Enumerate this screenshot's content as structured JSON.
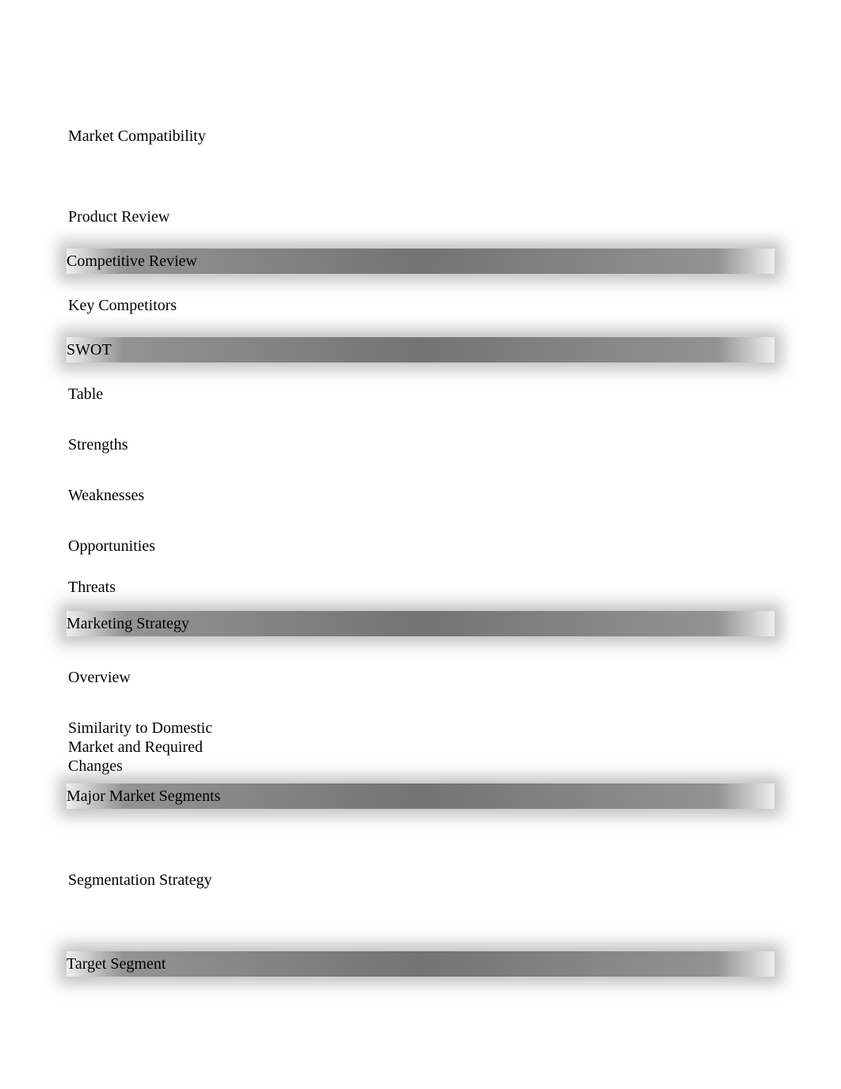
{
  "items": [
    {
      "type": "text",
      "text": "Market Compatibility",
      "spacer_after": "large"
    },
    {
      "type": "text",
      "text": "Product Review",
      "spacer_after": "small"
    },
    {
      "type": "heading",
      "text": "Competitive Review",
      "spacer_after": "small"
    },
    {
      "type": "text",
      "text": "Key Competitors",
      "spacer_after": "small"
    },
    {
      "type": "heading",
      "text": "SWOT",
      "spacer_after": "small"
    },
    {
      "type": "text",
      "text": "Table",
      "spacer_after": "medium"
    },
    {
      "type": "text",
      "text": "Strengths",
      "spacer_after": "medium"
    },
    {
      "type": "text",
      "text": "Weaknesses",
      "spacer_after": "medium"
    },
    {
      "type": "text",
      "text": "Opportunities",
      "spacer_after": "small"
    },
    {
      "type": "text",
      "text": "Threats",
      "spacer_after": "xsmall"
    },
    {
      "type": "heading",
      "text": "Marketing Strategy",
      "spacer_after": "medium"
    },
    {
      "type": "text",
      "text": "Overview",
      "spacer_after": "medium"
    },
    {
      "type": "multiline",
      "lines": [
        "Similarity to Domestic",
        "Market and Required",
        "Changes"
      ],
      "spacer_after": "tiny"
    },
    {
      "type": "heading",
      "text": "Major Market Segments",
      "spacer_after": "large"
    },
    {
      "type": "text",
      "text": "Segmentation Strategy",
      "spacer_after": "large"
    },
    {
      "type": "heading",
      "text": "Target Segment",
      "spacer_after": "none"
    }
  ]
}
